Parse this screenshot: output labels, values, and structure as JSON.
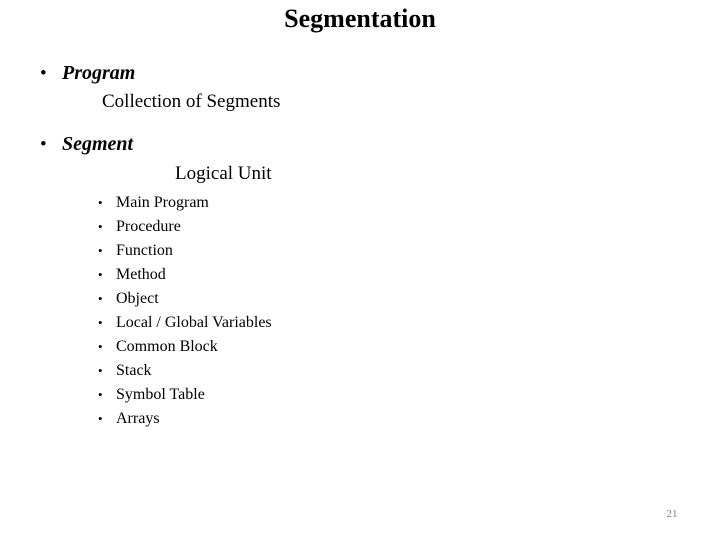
{
  "slide": {
    "title": "Segmentation",
    "page_number": "21",
    "bullet_marker": "•",
    "sub_bullet_marker": "•",
    "text_color": "#000000",
    "background_color": "#ffffff",
    "page_number_color": "#808080"
  },
  "topics": [
    {
      "heading": "Program",
      "description": "Collection of Segments"
    },
    {
      "heading": "Segment",
      "description": "Logical Unit"
    }
  ],
  "segment_examples": [
    {
      "label": "Main Program"
    },
    {
      "label": "Procedure"
    },
    {
      "label": "Function"
    },
    {
      "label": "Method"
    },
    {
      "label": "Object"
    },
    {
      "label": "Local / Global Variables"
    },
    {
      "label": "Common Block"
    },
    {
      "label": "Stack"
    },
    {
      "label": "Symbol Table"
    },
    {
      "label": "Arrays"
    }
  ]
}
